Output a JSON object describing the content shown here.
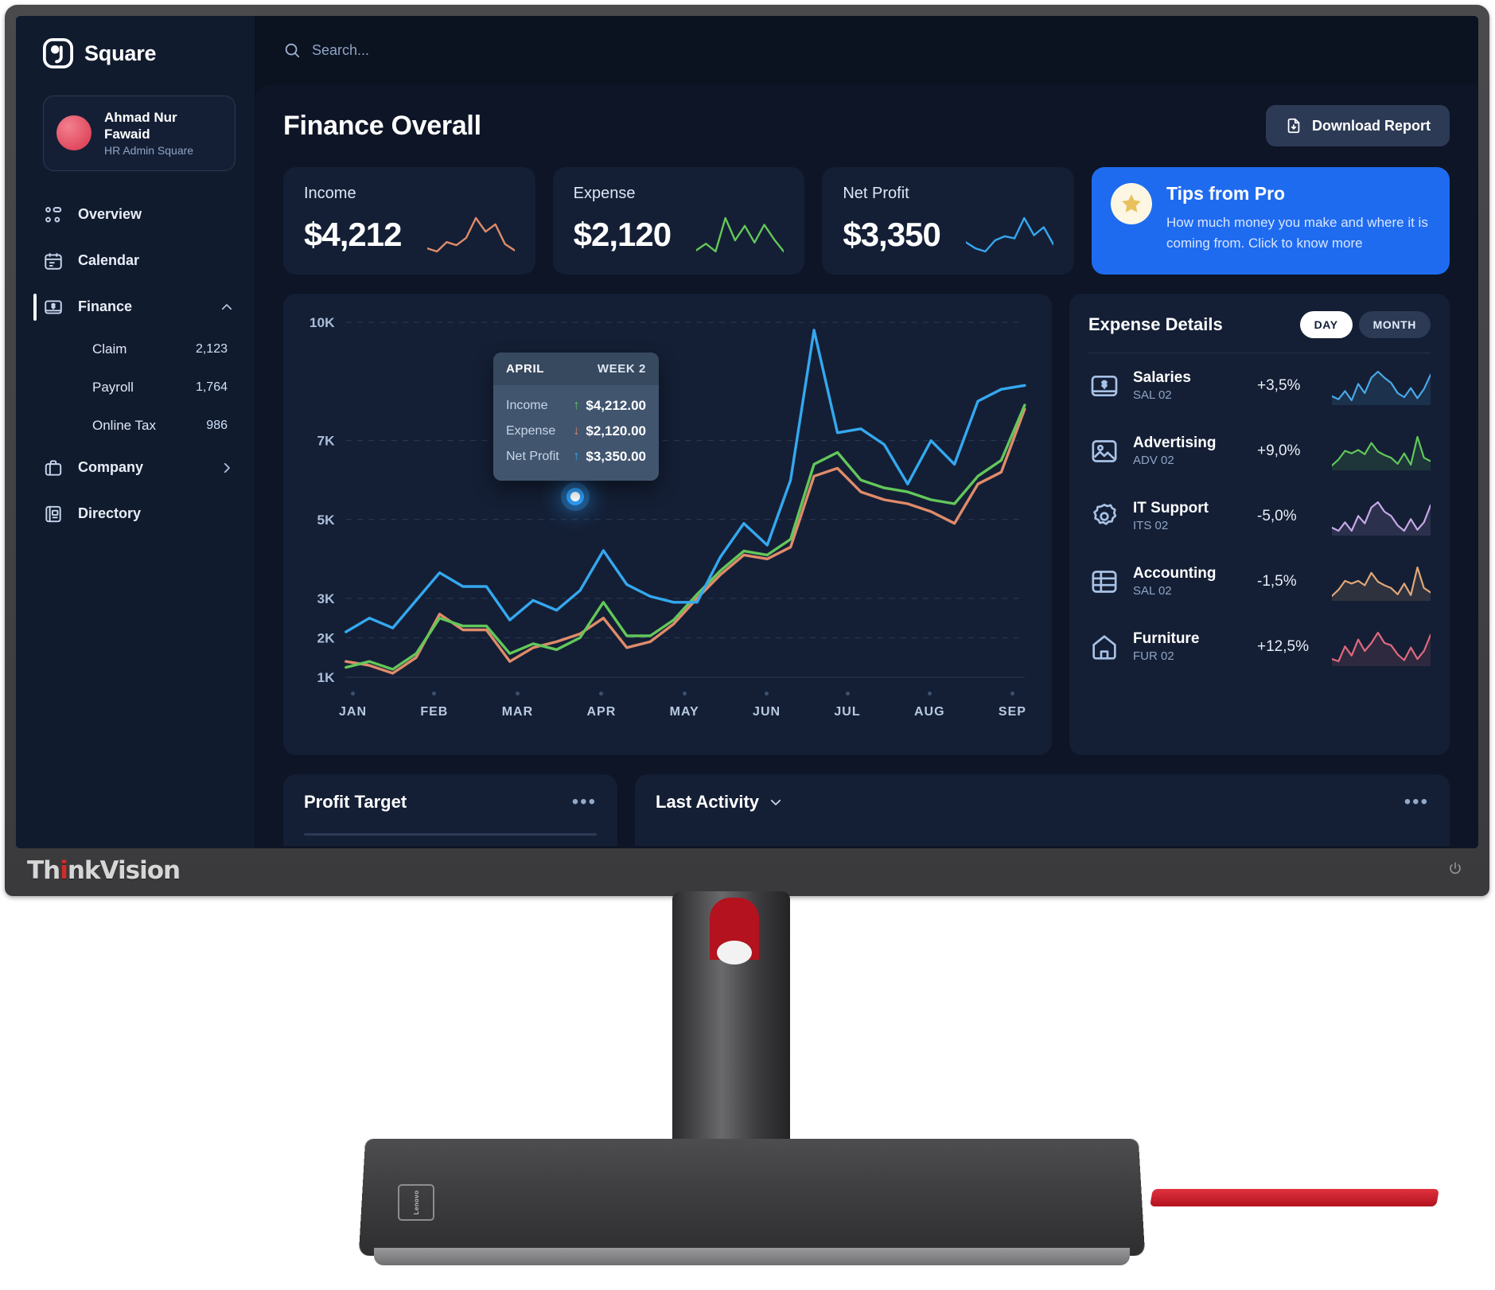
{
  "device": {
    "brand": "ThinkVision",
    "brand_dot": "i",
    "vendor_badge": "Lenovo"
  },
  "sidebar": {
    "brand": {
      "name": "Square",
      "logo_icon": "square-logo-icon"
    },
    "profile": {
      "name": "Ahmad Nur Fawaid",
      "role": "HR Admin Square",
      "avatar_icon": "avatar"
    },
    "items": [
      {
        "label": "Overview",
        "icon": "grid-icon",
        "active": false
      },
      {
        "label": "Calendar",
        "icon": "calendar-icon",
        "active": false
      },
      {
        "label": "Finance",
        "icon": "finance-bill-icon",
        "active": true,
        "chevron": "chevron-up-icon"
      },
      {
        "label": "Company",
        "icon": "briefcase-icon",
        "active": false,
        "chevron": "chevron-right-icon"
      },
      {
        "label": "Directory",
        "icon": "address-book-icon",
        "active": false
      }
    ],
    "sub_items": [
      {
        "label": "Claim",
        "count": "2,123"
      },
      {
        "label": "Payroll",
        "count": "1,764"
      },
      {
        "label": "Online Tax",
        "count": "986"
      }
    ]
  },
  "topbar": {
    "search_placeholder": "Search...",
    "search_value": "",
    "search_icon": "search-icon"
  },
  "header": {
    "title": "Finance Overall",
    "download_label": "Download Report",
    "download_icon": "file-download-icon"
  },
  "stats": [
    {
      "label": "Income",
      "value": "$4,212",
      "color": "#e08b6a"
    },
    {
      "label": "Expense",
      "value": "$2,120",
      "color": "#63c75a"
    },
    {
      "label": "Net Profit",
      "value": "$3,350",
      "color": "#34a8ef"
    }
  ],
  "tips": {
    "title": "Tips from Pro",
    "description": "How much money you make and where it is coming from. Click to know more",
    "icon": "star-icon",
    "bg": "#1e6bf0"
  },
  "tooltip": {
    "month": "APRIL",
    "week": "WEEK 2",
    "rows": [
      {
        "key": "Income",
        "arrow": "↑",
        "value": "$4,212.00",
        "arrow_color": "#63c75a"
      },
      {
        "key": "Expense",
        "arrow": "↓",
        "value": "$2,120.00",
        "arrow_color": "#e08b6a"
      },
      {
        "key": "Net Profit",
        "arrow": "↑",
        "value": "$3,350.00",
        "arrow_color": "#34a8ef"
      }
    ]
  },
  "expense_details": {
    "title": "Expense Details",
    "toggle": {
      "options": [
        "DAY",
        "MONTH"
      ],
      "selected": "DAY"
    },
    "rows": [
      {
        "name": "Salaries",
        "code": "SAL 02",
        "pct": "+3,5%",
        "icon": "bill-icon",
        "color": "#4aa8e8"
      },
      {
        "name": "Advertising",
        "code": "ADV 02",
        "pct": "+9,0%",
        "icon": "image-icon",
        "color": "#63c75a"
      },
      {
        "name": "IT Support",
        "code": "ITS 02",
        "pct": "-5,0%",
        "icon": "gear-icon",
        "color": "#c8a8e8"
      },
      {
        "name": "Accounting",
        "code": "SAL 02",
        "pct": "-1,5%",
        "icon": "table-icon",
        "color": "#e0a878"
      },
      {
        "name": "Furniture",
        "code": "FUR 02",
        "pct": "+12,5%",
        "icon": "home-icon",
        "color": "#e0697f"
      }
    ]
  },
  "bottom": {
    "profit_target": {
      "title": "Profit Target",
      "menu_icon": "more-dots-icon"
    },
    "last_activity": {
      "title": "Last Activity",
      "chevron": "chevron-down-icon",
      "menu_icon": "more-dots-icon"
    }
  },
  "chart_data": {
    "type": "line",
    "title": "Finance Overall",
    "xlabel": "",
    "ylabel": "",
    "grid": true,
    "legend": "none",
    "categories": [
      "JAN",
      "FEB",
      "MAR",
      "APR",
      "MAY",
      "JUN",
      "JUL",
      "AUG",
      "SEP"
    ],
    "ytick_labels": [
      "10K",
      "7K",
      "5K",
      "3K",
      "2K",
      "1K"
    ],
    "ytick_values": [
      10000,
      7000,
      5000,
      3000,
      2000,
      1000
    ],
    "ylim": [
      1000,
      10000
    ],
    "highlight": {
      "x": "APR",
      "label": "WEEK 2",
      "income": 4212,
      "expense": 2120,
      "net_profit": 3350
    },
    "series": [
      {
        "name": "Net Profit",
        "color": "#34a8ef",
        "values": [
          2150,
          2500,
          2250,
          2950,
          3650,
          3300,
          3300,
          2450,
          2950,
          2700,
          3200,
          4212,
          3350,
          3050,
          2900,
          2900,
          4050,
          4900,
          4350,
          6000,
          9800,
          7200,
          7300,
          6900,
          5900,
          7000,
          6400,
          8000,
          8300,
          8400
        ]
      },
      {
        "name": "Expense",
        "color": "#63c75a",
        "values": [
          1250,
          1400,
          1200,
          1600,
          2500,
          2300,
          2300,
          1600,
          1850,
          1700,
          2000,
          2900,
          2050,
          2050,
          2450,
          3100,
          3700,
          4200,
          4100,
          4500,
          6400,
          6700,
          6000,
          5800,
          5700,
          5500,
          5400,
          6100,
          6500,
          7900
        ]
      },
      {
        "name": "Income",
        "color": "#e08b6a",
        "values": [
          1400,
          1300,
          1100,
          1500,
          2600,
          2200,
          2200,
          1400,
          1750,
          1900,
          2100,
          2500,
          1750,
          1900,
          2350,
          3000,
          3600,
          4100,
          4000,
          4300,
          6100,
          6300,
          5700,
          5500,
          5400,
          5200,
          4900,
          5900,
          6200,
          7800
        ]
      }
    ],
    "stat_sparklines": [
      {
        "name": "Income",
        "color": "#e08b6a",
        "values": [
          28,
          22,
          40,
          34,
          48,
          86,
          60,
          74,
          36,
          24
        ]
      },
      {
        "name": "Expense",
        "color": "#63c75a",
        "values": [
          26,
          38,
          24,
          84,
          44,
          70,
          40,
          72,
          46,
          24
        ]
      },
      {
        "name": "Net Profit",
        "color": "#34a8ef",
        "values": [
          40,
          28,
          22,
          44,
          52,
          48,
          88,
          54,
          70,
          36
        ]
      }
    ],
    "expense_sparklines": [
      {
        "name": "Salaries",
        "color": "#4aa8e8",
        "values": [
          38,
          32,
          48,
          30,
          62,
          44,
          74,
          86,
          74,
          64,
          44,
          36,
          54,
          34,
          52,
          80
        ]
      },
      {
        "name": "Advertising",
        "color": "#63c75a",
        "values": [
          26,
          40,
          60,
          54,
          62,
          52,
          78,
          58,
          50,
          44,
          30,
          54,
          28,
          92,
          44,
          36
        ]
      },
      {
        "name": "IT Support",
        "color": "#c8a8e8",
        "values": [
          40,
          34,
          50,
          34,
          62,
          48,
          78,
          88,
          70,
          62,
          44,
          34,
          56,
          36,
          50,
          82
        ]
      },
      {
        "name": "Accounting",
        "color": "#e0a878",
        "values": [
          28,
          42,
          62,
          56,
          62,
          52,
          80,
          60,
          52,
          46,
          32,
          56,
          30,
          92,
          46,
          36
        ]
      },
      {
        "name": "Furniture",
        "color": "#e0697f",
        "values": [
          34,
          30,
          56,
          40,
          68,
          48,
          62,
          80,
          62,
          58,
          42,
          32,
          54,
          34,
          48,
          76
        ]
      }
    ]
  }
}
